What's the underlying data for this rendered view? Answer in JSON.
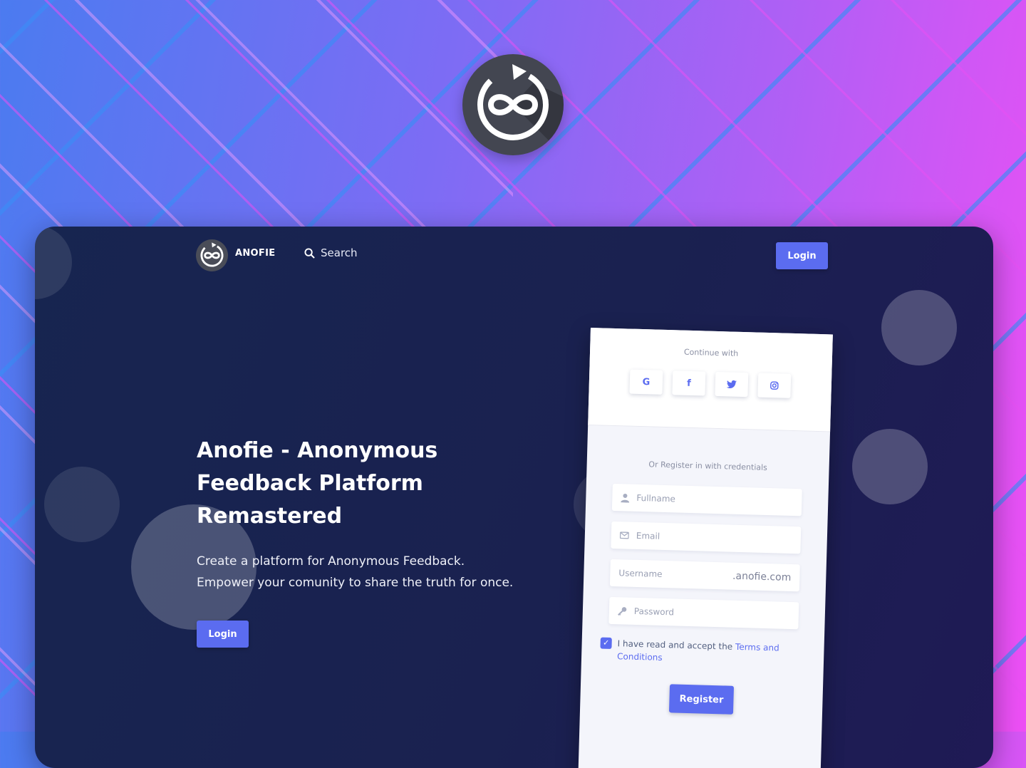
{
  "nav": {
    "brand": "ANOFIE",
    "search_label": "Search",
    "login_label": "Login"
  },
  "hero": {
    "title": "Anofie - Anonymous Feedback Platform Remastered",
    "subtitle_line1": "Create a platform for Anonymous Feedback.",
    "subtitle_line2": "Empower your comunity to share the truth for once.",
    "login_label": "Login"
  },
  "card": {
    "continue_with": "Continue with",
    "socials": [
      {
        "label": "G",
        "icon": "google-icon"
      },
      {
        "label": "f",
        "icon": "facebook-icon"
      },
      {
        "label": "twitter",
        "icon": "twitter-icon"
      },
      {
        "label": "instagram",
        "icon": "instagram-icon"
      }
    ],
    "or_register": "Or Register in with credentials",
    "fullname_placeholder": "Fullname",
    "email_placeholder": "Email",
    "username_placeholder": "Username",
    "username_suffix": ".anofie.com",
    "password_placeholder": "Password",
    "terms_text": "I have read and accept the",
    "terms_link": "Terms and Conditions",
    "register_label": "Register"
  },
  "colors": {
    "accent": "#5b6cf0",
    "window_bg": "#172550",
    "logo_bg": "#434651"
  }
}
